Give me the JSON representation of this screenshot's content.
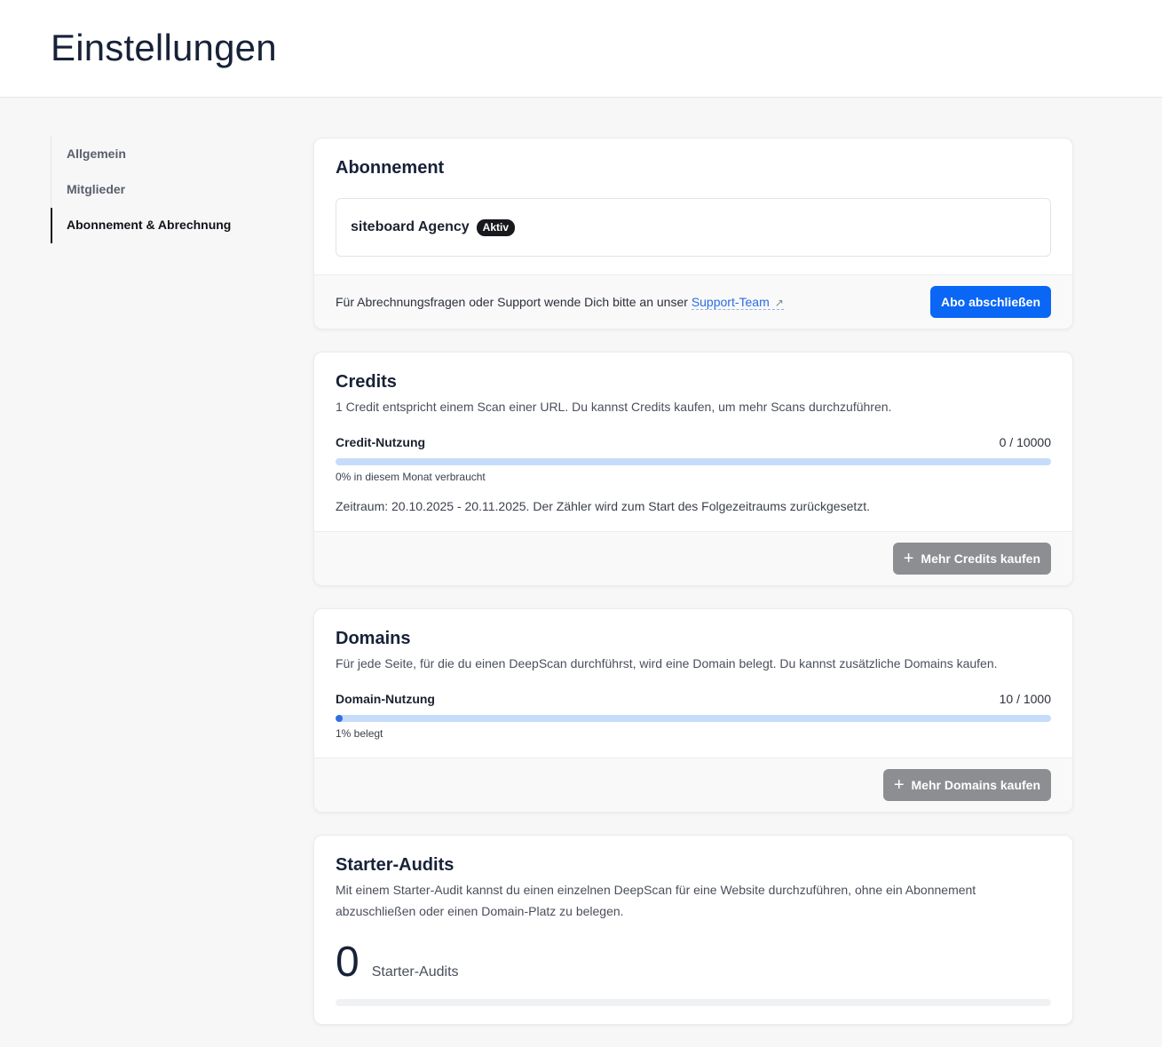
{
  "page": {
    "title": "Einstellungen"
  },
  "sidebar": {
    "items": [
      {
        "label": "Allgemein",
        "active": false
      },
      {
        "label": "Mitglieder",
        "active": false
      },
      {
        "label": "Abonnement & Abrechnung",
        "active": true
      }
    ]
  },
  "subscription": {
    "title": "Abonnement",
    "plan_name": "siteboard Agency",
    "plan_status": "Aktiv",
    "support_text": "Für Abrechnungsfragen oder Support wende Dich bitte an unser",
    "support_link": "Support-Team",
    "support_link_icon": "external-link-icon",
    "cta_label": "Abo abschließen"
  },
  "credits": {
    "title": "Credits",
    "description": "1 Credit entspricht einem Scan einer URL. Du kannst Credits kaufen, um mehr Scans durchzuführen.",
    "usage_label": "Credit-Nutzung",
    "usage_value": "0 / 10000",
    "usage_fraction": 0,
    "usage_note": "0% in diesem Monat verbraucht",
    "period": "Zeitraum: 20.10.2025 - 20.11.2025. Der Zähler wird zum Start des Folgezeitraums zurückgesetzt.",
    "buy_label": "Mehr Credits kaufen"
  },
  "domains": {
    "title": "Domains",
    "description": "Für jede Seite, für die du einen DeepScan durchführst, wird eine Domain belegt. Du kannst zusätzliche Domains kaufen.",
    "usage_label": "Domain-Nutzung",
    "usage_value": "10 / 1000",
    "usage_fraction": 0.01,
    "usage_note": "1% belegt",
    "buy_label": "Mehr Domains kaufen"
  },
  "starter_audits": {
    "title": "Starter-Audits",
    "description": "Mit einem Starter-Audit kannst du einen einzelnen DeepScan für eine Website durchzuführen, ohne ein Abonnement abzuschließen oder einen Domain-Platz zu belegen.",
    "count": "0",
    "unit": "Starter-Audits"
  },
  "colors": {
    "primary": "#0a66f5",
    "bar_track": "#c6dcfa",
    "bar_fill": "#2f6fe6",
    "disabled_button": "#8d8e91"
  }
}
